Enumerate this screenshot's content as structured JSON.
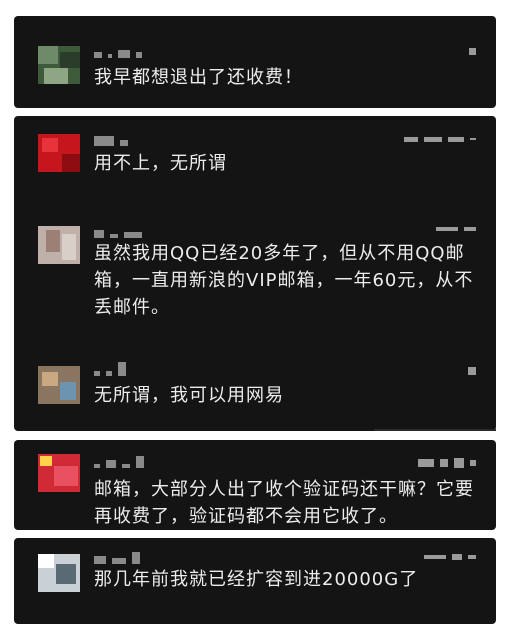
{
  "cards": [
    {
      "comments": [
        {
          "text": "我早都想退出了还收费！"
        }
      ]
    },
    {
      "comments": [
        {
          "text": "用不上，无所谓"
        },
        {
          "text": "虽然我用QQ已经20多年了，但从不用QQ邮箱，一直用新浪的VIP邮箱，一年60元，从不丢邮件。"
        },
        {
          "text": "无所谓，我可以用网易"
        }
      ]
    },
    {
      "comments": [
        {
          "text": "邮箱，大部分人出了收个验证码还干嘛？它要再收费了，验证码都不会用它收了。"
        }
      ]
    },
    {
      "comments": [
        {
          "text": "那几年前我就已经扩容到进20000G了"
        }
      ]
    }
  ]
}
